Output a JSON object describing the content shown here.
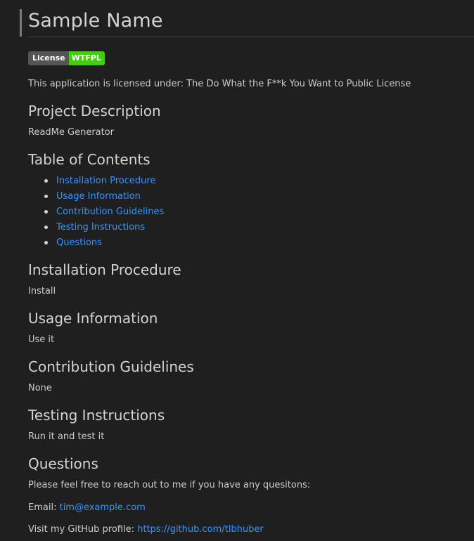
{
  "title": "Sample Name",
  "badge": {
    "left": "License",
    "right": "WTFPL"
  },
  "license_text": "This application is licensed under: The Do What the F**k You Want to Public License",
  "sections": {
    "description": {
      "heading": "Project Description",
      "body": "ReadMe Generator"
    },
    "toc": {
      "heading": "Table of Contents",
      "items": [
        "Installation Procedure",
        "Usage Information",
        "Contribution Guidelines",
        "Testing Instructions",
        "Questions"
      ]
    },
    "installation": {
      "heading": "Installation Procedure",
      "body": "Install"
    },
    "usage": {
      "heading": "Usage Information",
      "body": "Use it"
    },
    "contribution": {
      "heading": "Contribution Guidelines",
      "body": "None"
    },
    "testing": {
      "heading": "Testing Instructions",
      "body": "Run it and test it"
    },
    "questions": {
      "heading": "Questions",
      "intro": "Please feel free to reach out to me if you have any quesitons:",
      "email_label": "Email:",
      "email": "tim@example.com",
      "github_label": "Visit my GitHub profile:",
      "github": "https://github.com/tlbhuber"
    }
  }
}
